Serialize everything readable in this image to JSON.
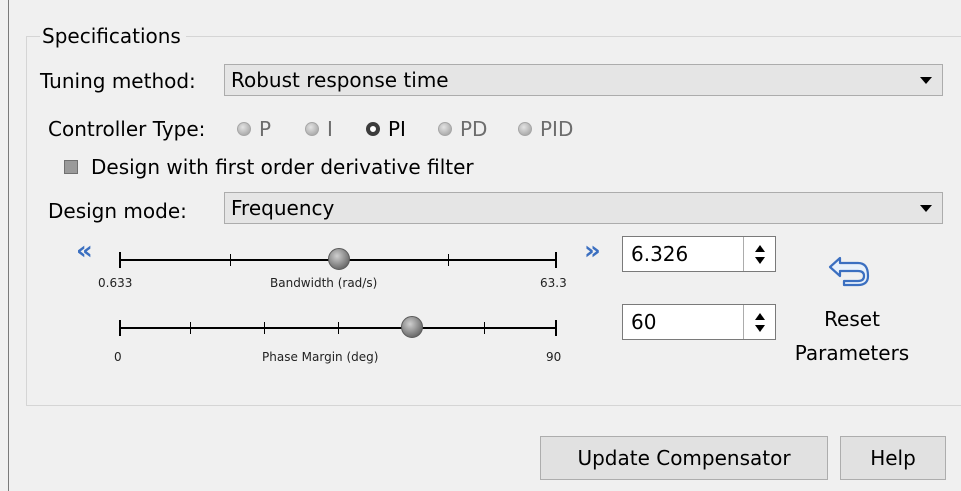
{
  "specifications": {
    "title": "Specifications",
    "tuning_method": {
      "label": "Tuning method:",
      "value": "Robust response time"
    },
    "controller_type": {
      "label": "Controller Type:",
      "options": [
        "P",
        "I",
        "PI",
        "PD",
        "PID"
      ],
      "selected": "PI"
    },
    "derivative_filter": {
      "label": "Design with first order derivative filter",
      "checked": false
    },
    "design_mode": {
      "label": "Design mode:",
      "value": "Frequency"
    },
    "bandwidth": {
      "min_label": "0.633",
      "max_label": "63.3",
      "caption": "Bandwidth (rad/s)",
      "value": "6.326",
      "min": 0.633,
      "max": 63.3,
      "scale": "log"
    },
    "phase_margin": {
      "min_label": "0",
      "max_label": "90",
      "caption": "Phase Margin (deg)",
      "value": "60",
      "min": 0,
      "max": 90
    },
    "reset": {
      "line1": "Reset",
      "line2": "Parameters"
    }
  },
  "buttons": {
    "update": "Update Compensator",
    "help": "Help"
  },
  "icons": {
    "decrease": "double-chevron-left-icon",
    "increase": "double-chevron-right-icon",
    "reset": "undo-arrow-icon"
  },
  "colors": {
    "accent": "#3b6fc0"
  }
}
